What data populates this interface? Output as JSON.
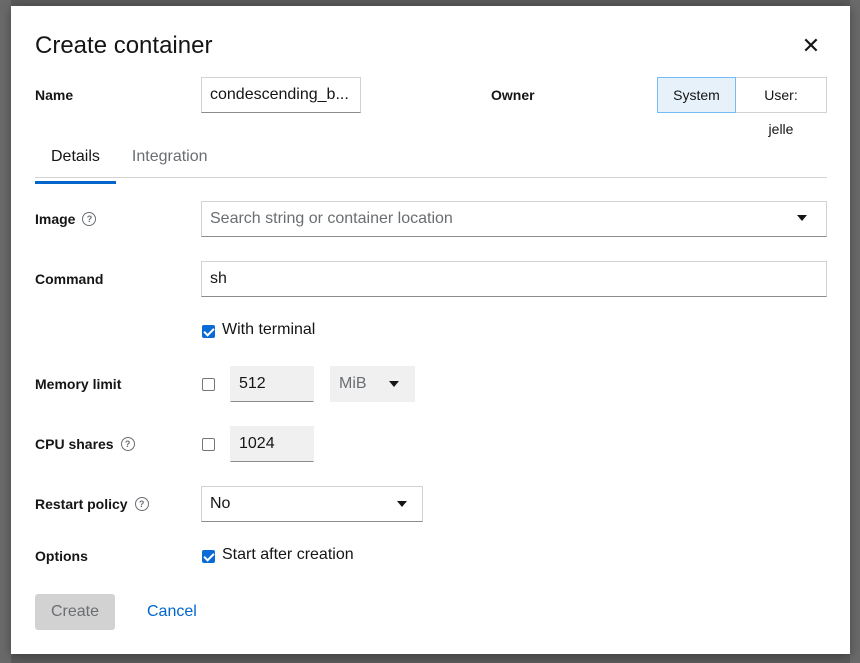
{
  "dialog": {
    "title": "Create container",
    "close_icon": "close-icon"
  },
  "name": {
    "label": "Name",
    "value": "condescending_b..."
  },
  "owner": {
    "label": "Owner",
    "options": [
      "System",
      "User: jelle"
    ],
    "selected": "System"
  },
  "tabs": [
    {
      "label": "Details",
      "active": true
    },
    {
      "label": "Integration",
      "active": false
    }
  ],
  "image": {
    "label": "Image",
    "placeholder": "Search string or container location"
  },
  "command": {
    "label": "Command",
    "value": "sh"
  },
  "terminal": {
    "label": "With terminal",
    "checked": true
  },
  "memory": {
    "label": "Memory limit",
    "enabled": false,
    "value": "512",
    "unit": "MiB"
  },
  "cpu": {
    "label": "CPU shares",
    "enabled": false,
    "value": "1024"
  },
  "restart": {
    "label": "Restart policy",
    "value": "No"
  },
  "options": {
    "label": "Options",
    "start_after_creation": {
      "label": "Start after creation",
      "checked": true
    }
  },
  "footer": {
    "create_label": "Create",
    "cancel_label": "Cancel"
  },
  "colors": {
    "accent": "#0066cc",
    "checkbox": "#0b6bd6",
    "selected_toggle": "#e7f1fa"
  }
}
